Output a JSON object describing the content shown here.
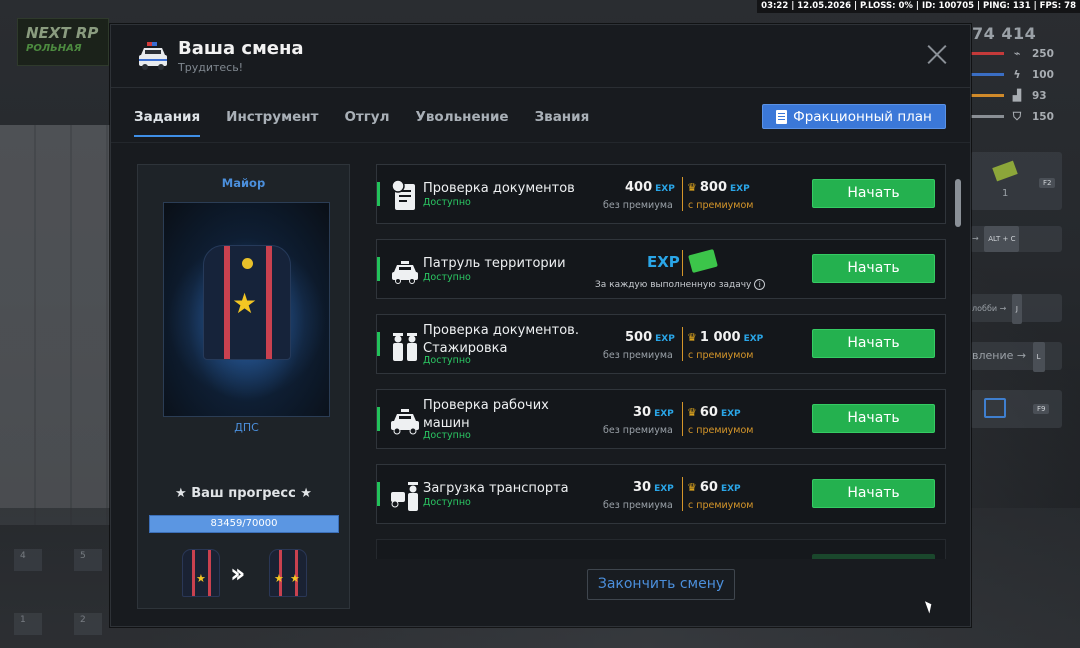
{
  "hud": {
    "top_status": "03:22 | 12.05.2026 | P.LOSS: 0% | ID: 100705 | PING: 131 | FPS: 78",
    "logo": "NEXT RP",
    "logo_sub": "РОЛЬНАЯ",
    "money": "74 414",
    "stats": [
      {
        "value": "250",
        "color": "#c43a3a"
      },
      {
        "value": "100",
        "color": "#3a6ec4"
      },
      {
        "value": "93",
        "color": "#d08a2a"
      },
      {
        "value": "150",
        "color": "#8a8f95"
      }
    ],
    "inv_count": "1",
    "inv_key": "F2",
    "alt_c": "ALT + C",
    "lobby": "лобби",
    "lobby_key": "J",
    "manage": "вление",
    "manage_key": "L",
    "calendar_key": "F9",
    "left_keys": [
      "4",
      "5",
      "1",
      "2"
    ]
  },
  "window": {
    "title": "Ваша смена",
    "subtitle": "Трудитесь!"
  },
  "tabs": [
    {
      "label": "Задания",
      "active": true
    },
    {
      "label": "Инструмент",
      "active": false
    },
    {
      "label": "Отгул",
      "active": false
    },
    {
      "label": "Увольнение",
      "active": false
    },
    {
      "label": "Звания",
      "active": false
    }
  ],
  "faction_plan_label": "Фракционный план",
  "rank": {
    "name": "Майор",
    "department": "ДПС",
    "progress_label": "★ Ваш прогресс ★",
    "progress_text": "83459/70000",
    "progress_fraction": 1.0
  },
  "tasks": [
    {
      "name": "Проверка документов",
      "status": "Доступно",
      "base": "400",
      "premium": "800",
      "exp": "EXP",
      "base_sub": "без премиума",
      "prem_sub": "с премиумом",
      "button": "Начать",
      "icon": "document-icon"
    },
    {
      "name": "Патруль территории",
      "status": "Доступно",
      "exp": "EXP",
      "note": "За каждую выполненную задачу",
      "button": "Начать",
      "icon": "police-car-icon"
    },
    {
      "name": "Проверка документов. Стажировка",
      "status": "Доступно",
      "base": "500",
      "premium": "1 000",
      "exp": "EXP",
      "base_sub": "без премиума",
      "prem_sub": "с премиумом",
      "button": "Начать",
      "icon": "officers-icon"
    },
    {
      "name": "Проверка рабочих машин",
      "status": "Доступно",
      "base": "30",
      "premium": "60",
      "exp": "EXP",
      "base_sub": "без премиума",
      "prem_sub": "с премиумом",
      "button": "Начать",
      "icon": "police-car-icon"
    },
    {
      "name": "Загрузка транспорта",
      "status": "Доступно",
      "base": "30",
      "premium": "60",
      "exp": "EXP",
      "base_sub": "без премиума",
      "prem_sub": "с премиумом",
      "button": "Начать",
      "icon": "tow-officer-icon"
    }
  ],
  "end_shift_label": "Закончить смену",
  "colors": {
    "accent_blue": "#3b78d8",
    "start_green": "#24b14f",
    "exp_blue": "#2aa6e8",
    "premium_gold": "#d5962a",
    "status_green": "#2bc763"
  }
}
